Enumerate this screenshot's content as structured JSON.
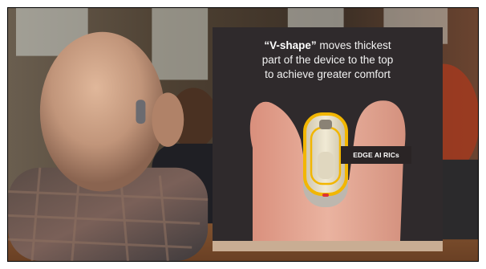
{
  "slide": {
    "caption": {
      "bold": "“V-shape”",
      "line1_rest": " moves thickest",
      "line2": "part of the device to the top",
      "line3": "to achieve greater comfort"
    },
    "device_label": "EDGE AI RICs"
  },
  "colors": {
    "panel": "#2f2a2c",
    "highlight_outline": "#f2b600",
    "skin": "#e5a896",
    "device_body": "#e8dfc8"
  }
}
